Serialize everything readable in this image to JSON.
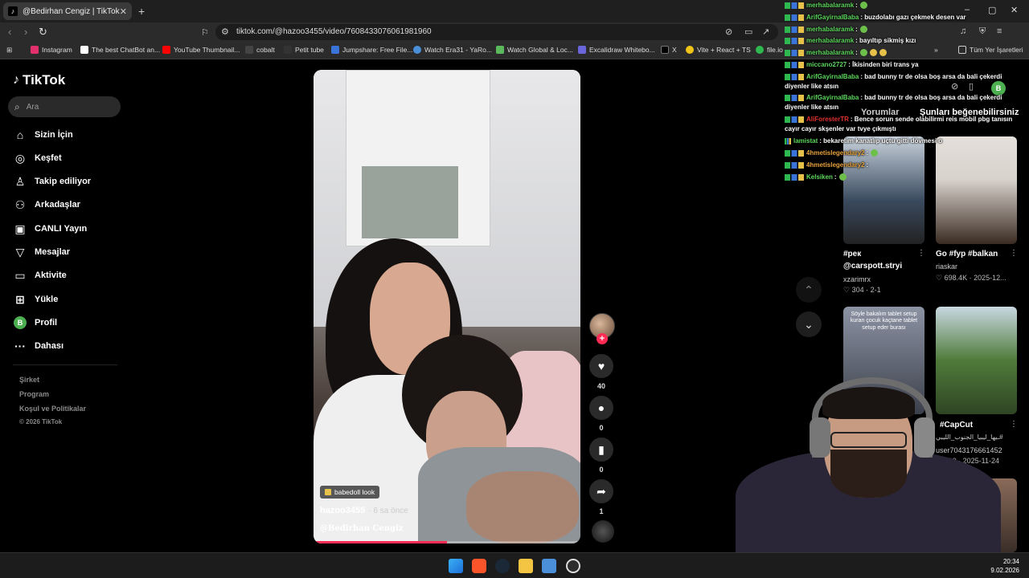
{
  "browser": {
    "tab_title": "@Bedirhan Cengiz | TikTok",
    "tab_close": "✕",
    "new_tab": "+",
    "url": "tiktok.com/@hazoo3455/video/7608433076061981960",
    "bookmarks": [
      {
        "label": "Instagram",
        "color": "#e1306c"
      },
      {
        "label": "The best ChatBot an...",
        "color": "#ffffff"
      },
      {
        "label": "YouTube Thumbnail...",
        "color": "#ff0000"
      },
      {
        "label": "cobalt",
        "color": "#222222"
      },
      {
        "label": "Petit tube",
        "color": "#111111"
      },
      {
        "label": "Jumpshare: Free File...",
        "color": "#3a74d9"
      },
      {
        "label": "Watch Era31 - YaRo...",
        "color": "#4a90d9"
      },
      {
        "label": "Watch Global & Loc...",
        "color": "#5cb85c"
      },
      {
        "label": "Excalidraw Whitebo...",
        "color": "#6965db"
      },
      {
        "label": "X",
        "color": "#000000"
      },
      {
        "label": "Vite + React + TS",
        "color": "#f0c419"
      },
      {
        "label": "file.io",
        "color": "#2fb84f"
      }
    ],
    "all_bookmarks": "Tüm Yer İşaretleri"
  },
  "sidebar": {
    "logo": "TikTok",
    "search_placeholder": "Ara",
    "nav": [
      {
        "label": "Sizin İçin",
        "icon": "home-icon",
        "glyph": "⌂"
      },
      {
        "label": "Keşfet",
        "icon": "compass-icon",
        "glyph": "◎"
      },
      {
        "label": "Takip ediliyor",
        "icon": "user-follow-icon",
        "glyph": "♙"
      },
      {
        "label": "Arkadaşlar",
        "icon": "friends-icon",
        "glyph": "⚇"
      },
      {
        "label": "CANLI Yayın",
        "icon": "live-icon",
        "glyph": "▣"
      },
      {
        "label": "Mesajlar",
        "icon": "messages-icon",
        "glyph": "▽"
      },
      {
        "label": "Aktivite",
        "icon": "activity-icon",
        "glyph": "▭"
      },
      {
        "label": "Yükle",
        "icon": "upload-icon",
        "glyph": "⊞"
      },
      {
        "label": "Profil",
        "icon": "profile-avatar",
        "glyph": "B"
      },
      {
        "label": "Dahası",
        "icon": "more-icon",
        "glyph": "···"
      }
    ],
    "footer": [
      "Şirket",
      "Program",
      "Koşul ve Politikalar",
      "© 2026 TikTok"
    ]
  },
  "video": {
    "tag": "babedoll look",
    "author": "hazoo3455",
    "posted_ago": "· 6 sa önce",
    "mention": "@Bedirhan Cengiz",
    "progress": 0.5,
    "likes": "40",
    "comments": "0",
    "saves": "0",
    "shares": "1"
  },
  "right_panel": {
    "tab_comments": "Yorumlar",
    "tab_suggested": "Şunları beğenebilirsiniz",
    "profile_initial": "B",
    "thumbs": [
      {
        "title": "#рек",
        "subtitle": "@carspott.stryi",
        "user": "xzarimrx",
        "stats": "♡ 304 · 2-1",
        "color_a": "#3a4a5e",
        "color_b": "#c9d3dd",
        "overlay": ""
      },
      {
        "title": "Go #fyp #balkan",
        "subtitle": "",
        "user": "riaskar",
        "stats": "♡ 698.4K · 2025-12...",
        "color_a": "#d8d2cc",
        "color_b": "#3a2b22",
        "overlay": ""
      },
      {
        "title": "",
        "subtitle": "",
        "user": "",
        "stats": "",
        "color_a": "#3b3f4a",
        "color_b": "#8c93a3",
        "overlay": "Söyle bakalım tablet setup kuran çocuk kaçtane tablet setup eder burası"
      },
      {
        "title": "#CapCut",
        "subtitle": "ـيها_ليبيا_الجنوب_الليبي#",
        "user": "user7043176661452",
        "stats": "♡ 310 · 2025-11-24",
        "color_a": "#4f7a3a",
        "color_b": "#2f4424",
        "overlay": ""
      }
    ]
  },
  "chat": [
    {
      "user": "merhabalaramk",
      "color": "#5cd65c",
      "text": ":"
    },
    {
      "user": "ArifGayirnalBaba",
      "color": "#5cd65c",
      "text": ": buzdolabı gazı çekmek desen var"
    },
    {
      "user": "merhabalaramk",
      "color": "#5cd65c",
      "text": ":"
    },
    {
      "user": "merhabalaramk",
      "color": "#5cd65c",
      "text": ": bayıltıp sikmiş kızı"
    },
    {
      "user": "merhabalaramk",
      "color": "#5cd65c",
      "text": ":"
    },
    {
      "user": "miccano2727",
      "color": "#5cd65c",
      "text": ": İkisinden biri trans ya"
    },
    {
      "user": "ArifGayirnalBaba",
      "color": "#5cd65c",
      "text": ": bad bunny tr de olsa boş arsa da bali çekerdi diyenler like atsın"
    },
    {
      "user": "ArifGayirnalBaba",
      "color": "#5cd65c",
      "text": ": bad bunny tr de olsa boş arsa da bali çekerdi diyenler like atsın"
    },
    {
      "user": "AliForesterTR",
      "color": "#e0312f",
      "text": ": Bence sorun sende olabilirmi reis mobil pbg tanısın cayır cayır skşenler var tvye çıkmıştı"
    },
    {
      "user": "lamistat",
      "color": "#5cd65c",
      "text": ": bekaretim kanatlıp uçtu gitti dövmesi o"
    },
    {
      "user": "4hmetislegendary2",
      "color": "#e6a23c",
      "text": ":"
    },
    {
      "user": "4hmetislegendary2",
      "color": "#e6a23c",
      "text": ":"
    },
    {
      "user": "Kelsiken",
      "color": "#5cd65c",
      "text": ":"
    }
  ],
  "taskbar": {
    "time": "20:34",
    "date": "9.02.2026"
  }
}
